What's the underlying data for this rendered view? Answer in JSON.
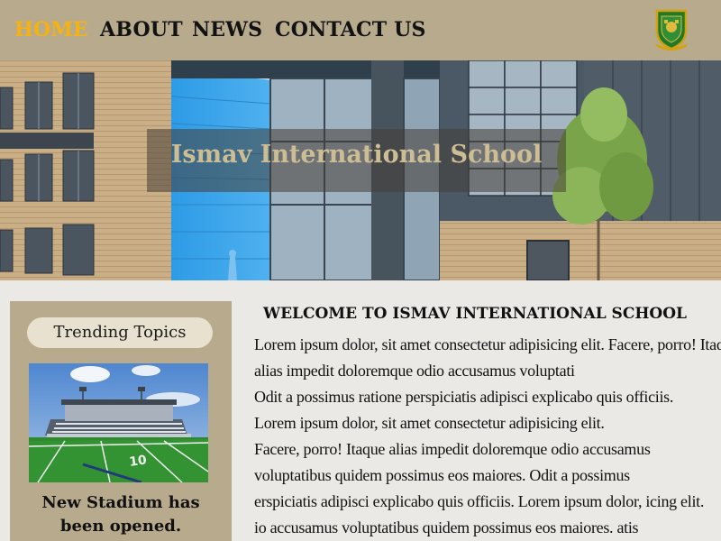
{
  "nav": {
    "items": [
      {
        "label": "HOME",
        "active": true
      },
      {
        "label": "ABOUT",
        "active": false
      },
      {
        "label": "NEWS",
        "active": false
      },
      {
        "label": "CONTACT US",
        "active": false
      }
    ],
    "logo_icon": "school-crest-icon"
  },
  "hero": {
    "title": "Ismav International School"
  },
  "sidebar": {
    "heading": "Trending Topics",
    "caption_line1": "New Stadium has",
    "caption_line2": "been opened."
  },
  "main": {
    "heading": "WELCOME TO ISMAV INTERNATIONAL SCHOOL",
    "lines": [
      "Lorem ipsum dolor, sit amet consectetur adipisicing elit. Facere, porro! Itaque",
      "alias impedit doloremque odio accusamus voluptati",
      "Odit a possimus ratione perspiciatis adipisci explicabo quis officiis.",
      "Lorem ipsum dolor, sit amet consectetur adipisicing elit.",
      "Facere, porro! Itaque alias impedit doloremque odio accusamus",
      "voluptatibus quidem possimus eos maiores. Odit a possimus",
      "erspiciatis adipisci explicabo quis officiis. Lorem ipsum dolor, icing elit.",
      "io accusamus voluptatibus quidem possimus eos maiores. atis"
    ]
  },
  "colors": {
    "nav_bg": "#b7aa8d",
    "active_link": "#f4b312",
    "page_bg": "#ebe9e6",
    "hero_title": "#cdbd94"
  }
}
